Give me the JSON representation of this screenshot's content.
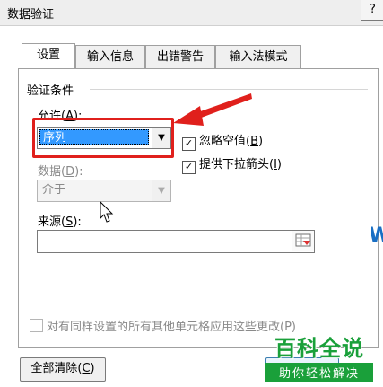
{
  "window": {
    "title": "数据验证",
    "help_label": "?"
  },
  "tabs": [
    {
      "label": "设置",
      "active": true
    },
    {
      "label": "输入信息",
      "active": false
    },
    {
      "label": "出错警告",
      "active": false
    },
    {
      "label": "输入法模式",
      "active": false
    }
  ],
  "section": {
    "title": "验证条件"
  },
  "allow": {
    "label_pre": "允许(",
    "key": "A",
    "label_post": "):",
    "value": "序列"
  },
  "ignore_blank": {
    "label_pre": "忽略空值(",
    "key": "B",
    "label_post": ")",
    "checked": true
  },
  "dropdown": {
    "label_pre": "提供下拉箭头(",
    "key": "I",
    "label_post": ")",
    "checked": true
  },
  "data": {
    "label_pre": "数据(",
    "key": "D",
    "label_post": "):",
    "value": "介于"
  },
  "source": {
    "label_pre": "来源(",
    "key": "S",
    "label_post": "):",
    "value": ""
  },
  "apply_all": {
    "label": "对有同样设置的所有其他单元格应用这些更改(P)",
    "checked": false
  },
  "buttons": {
    "clear_pre": "全部清除(",
    "clear_key": "C",
    "clear_post": ")"
  },
  "watermark": {
    "main": "百科全说",
    "sub": "助你轻松解决"
  },
  "colors": {
    "highlight_red": "#e0201c",
    "selection_blue": "#3399ff",
    "watermark_green": "#1aa03a"
  },
  "icons": {
    "checkmark": "✓",
    "dropdown_arrow": "▼"
  }
}
